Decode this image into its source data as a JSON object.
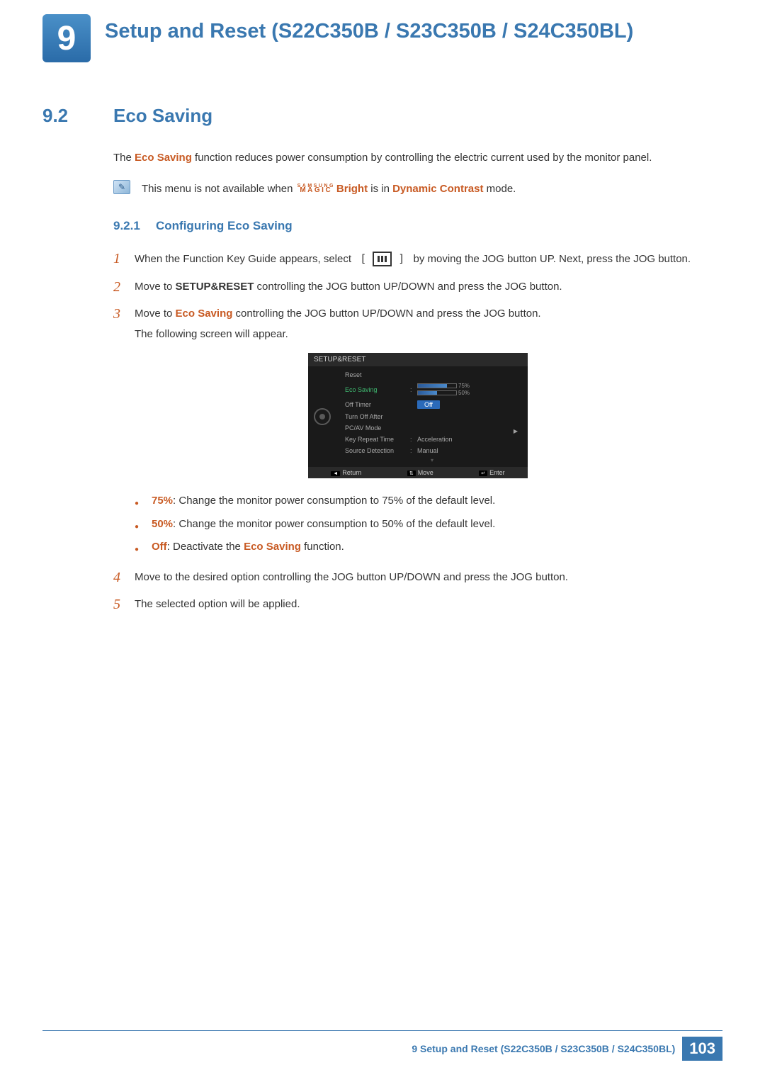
{
  "chapter": {
    "num": "9",
    "title": "Setup and Reset (S22C350B / S23C350B / S24C350BL)"
  },
  "section": {
    "num": "9.2",
    "title": "Eco Saving"
  },
  "intro": {
    "prefix": "The ",
    "feature": "Eco Saving",
    "rest": " function reduces power consumption by controlling the electric current used by the monitor panel."
  },
  "note": {
    "prefix": "This menu is not available when ",
    "magic_top": "SAMSUNG",
    "magic_bot": "MAGIC",
    "bright": "Bright",
    "mid": " is in ",
    "mode": "Dynamic Contrast",
    "suffix": " mode."
  },
  "subsection": {
    "num": "9.2.1",
    "title": "Configuring Eco Saving"
  },
  "steps": [
    {
      "num": "1",
      "parts": {
        "a": "When the Function Key Guide appears, select ",
        "lb": "[",
        "rb": "]",
        "b": " by moving the JOG button UP. Next, press the JOG button."
      }
    },
    {
      "num": "2",
      "parts": {
        "a": "Move to ",
        "bold": "SETUP&RESET",
        "b": " controlling the JOG button UP/DOWN and press the JOG button."
      }
    },
    {
      "num": "3",
      "parts": {
        "a": "Move to ",
        "em": "Eco Saving",
        "b": " controlling the JOG button UP/DOWN and press the JOG button.",
        "c": "The following screen will appear."
      }
    },
    {
      "num": "4",
      "parts": {
        "a": "Move to the desired option controlling the JOG button UP/DOWN and press the JOG button."
      }
    },
    {
      "num": "5",
      "parts": {
        "a": "The selected option will be applied."
      }
    }
  ],
  "osd": {
    "title": "SETUP&RESET",
    "items": {
      "reset": "Reset",
      "eco": "Eco Saving",
      "off_timer": "Off Timer",
      "turn_off_after": "Turn Off After",
      "pcav": "PC/AV Mode",
      "key_repeat": "Key Repeat Time",
      "source_det": "Source Detection"
    },
    "values": {
      "bar75": "75%",
      "bar50": "50%",
      "off_pill": "Off",
      "key_repeat": "Acceleration",
      "source_det": "Manual"
    },
    "footer": {
      "ret": "Return",
      "move": "Move",
      "enter": "Enter"
    }
  },
  "bullets": [
    {
      "label": "75%",
      "text": ": Change the monitor power consumption to 75% of the default level."
    },
    {
      "label": "50%",
      "text": ": Change the monitor power consumption to 50% of the default level."
    },
    {
      "label": "Off",
      "text_a": ": Deactivate the ",
      "em": "Eco Saving",
      "text_b": " function."
    }
  ],
  "footer": {
    "text": "9 Setup and Reset (S22C350B / S23C350B / S24C350BL)",
    "page": "103"
  }
}
